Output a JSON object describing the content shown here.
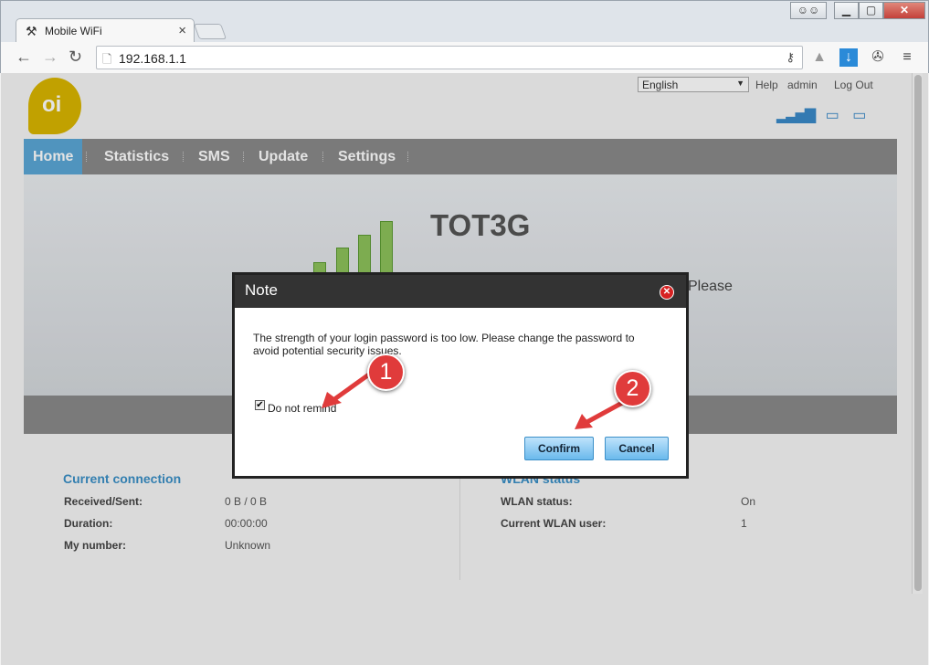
{
  "browser": {
    "tab_title": "Mobile WiFi",
    "tab_close": "×",
    "url": "192.168.1.1",
    "back_icon": "back-arrow-icon",
    "forward_icon": "forward-arrow-icon",
    "reload_icon": "reload-icon",
    "menu_icon": "hamburger-icon"
  },
  "header": {
    "logo_text": "oi",
    "language": "English",
    "help_label": "Help",
    "user_label": "admin",
    "logout_label": "Log Out"
  },
  "menu": {
    "items": [
      "Home",
      "Statistics",
      "SMS",
      "Update",
      "Settings"
    ]
  },
  "hero": {
    "carrier": "TOT3G",
    "partial_text": "Please"
  },
  "current_connection": {
    "title": "Current connection",
    "rows": [
      {
        "label": "Received/Sent:",
        "value": "0 B /  0 B"
      },
      {
        "label": "Duration:",
        "value": "00:00:00"
      },
      {
        "label": "My number:",
        "value": "Unknown"
      }
    ]
  },
  "wlan_status": {
    "title": "WLAN status",
    "rows": [
      {
        "label": "WLAN status:",
        "value": "On"
      },
      {
        "label": "Current WLAN user:",
        "value": "1"
      }
    ]
  },
  "dialog": {
    "title": "Note",
    "message": "The strength of your login password is too low. Please change the password to avoid potential security issues.",
    "checkbox_label": "Do not remind",
    "checkbox_checked": true,
    "confirm_label": "Confirm",
    "cancel_label": "Cancel"
  },
  "annotations": {
    "marker_1": "1",
    "marker_2": "2",
    "color": "#e03b3b"
  }
}
